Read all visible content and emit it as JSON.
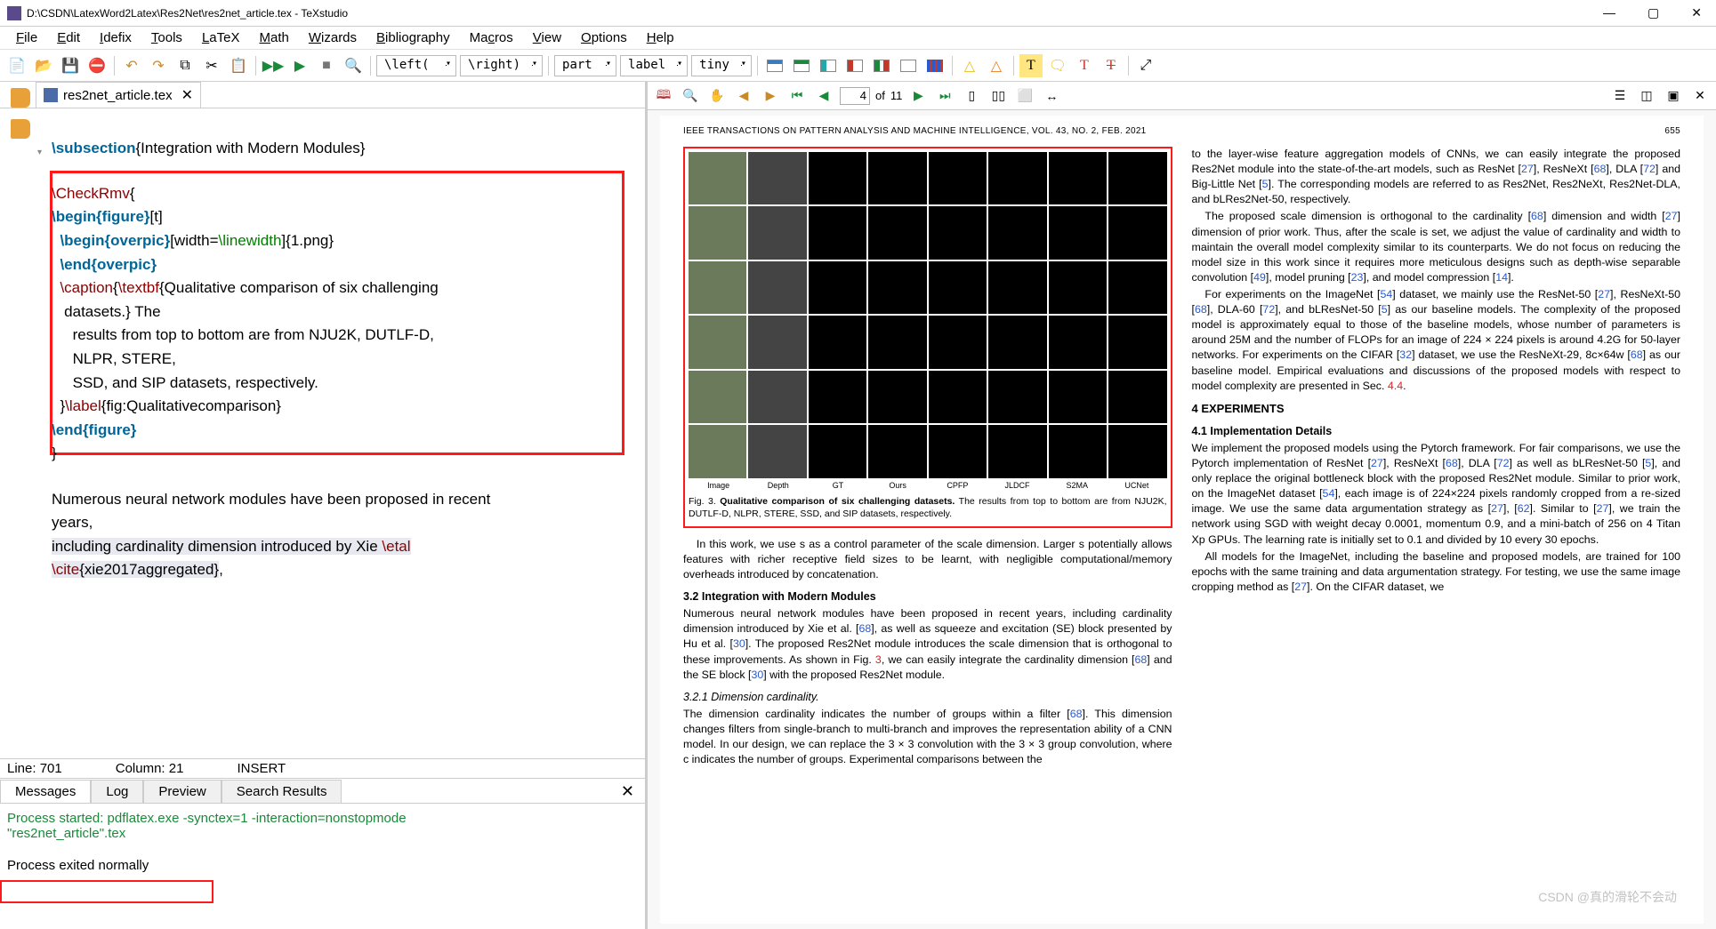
{
  "window": {
    "title": "D:\\CSDN\\LatexWord2Latex\\Res2Net\\res2net_article.tex - TeXstudio"
  },
  "menu": [
    "File",
    "Edit",
    "Idefix",
    "Tools",
    "LaTeX",
    "Math",
    "Wizards",
    "Bibliography",
    "Macros",
    "View",
    "Options",
    "Help"
  ],
  "combos": {
    "left": "\\left(",
    "right": "\\right)",
    "part": "part",
    "label": "label",
    "tiny": "tiny"
  },
  "tabs": {
    "file": "res2net_article.tex"
  },
  "code": {
    "l1a": "\\subsection",
    "l1b": "{Integration with Modern Modules}",
    "l3a": "\\CheckRmv",
    "l3b": "{",
    "l4a": "\\begin{figure}",
    "l4b": "[t]",
    "l5a": "  \\begin{overpic}",
    "l5b": "[width=",
    "l5c": "\\linewidth",
    "l5d": "]{1.png}",
    "l6a": "  \\end{overpic}",
    "l7a": "  \\caption",
    "l7b": "{",
    "l7c": "\\textbf",
    "l7d": "{Qualitative comparison of six challenging",
    "l8": "   datasets.}",
    "l8b": " The",
    "l9": "     results from top to bottom are from NJU2K, DUTLF-D,",
    "l10": "     NLPR, STERE,",
    "l11": "     SSD, and SIP datasets, respectively.",
    "l12a": "  }",
    "l12b": "\\label",
    "l12c": "{fig:Qualitativecomparison}",
    "l13a": "\\end{figure}",
    "l14": "}",
    "l16": "Numerous neural network modules have been proposed in recent",
    "l17": "years,",
    "l18a": "including cardinality dimension introduced by Xie ",
    "l18b": "\\etal",
    "l19a": "\\cite",
    "l19b": "{xie2017aggregated}",
    "l19c": ","
  },
  "status": {
    "line": "Line: 701",
    "col": "Column: 21",
    "mode": "INSERT"
  },
  "log": {
    "tabs": [
      "Messages",
      "Log",
      "Preview",
      "Search Results"
    ],
    "l1": "Process started: pdflatex.exe -synctex=1 -interaction=nonstopmode",
    "l2": "\"res2net_article\".tex",
    "l3": "Process exited normally"
  },
  "pdf": {
    "page_current": "4",
    "page_of": "of",
    "page_total": "11",
    "header_left": "IEEE TRANSACTIONS ON PATTERN ANALYSIS AND MACHINE INTELLIGENCE, VOL. 43, NO. 2, FEB. 2021",
    "header_right": "655",
    "fig_labels": [
      "Image",
      "Depth",
      "GT",
      "Ours",
      "CPFP",
      "JLDCF",
      "S2MA",
      "UCNet"
    ],
    "fig_caption_a": "Fig. 3. ",
    "fig_caption_b": "Qualitative comparison of six challenging datasets.",
    "fig_caption_c": " The results from top to bottom are from NJU2K, DUTLF-D, NLPR, STERE, SSD, and SIP datasets, respectively.",
    "leftcol": {
      "p1": "In this work, we use s as a control parameter of the scale dimension. Larger s potentially allows features with richer receptive field sizes to be learnt, with negligible computational/memory overheads introduced by concatenation.",
      "h1": "3.2   Integration with Modern Modules",
      "p2a": "Numerous neural network modules have been proposed in recent years, including cardinality dimension introduced by Xie et al. [",
      "p2b": "], as well as squeeze and excitation (SE) block presented by Hu et al. [",
      "p2c": "]. The proposed Res2Net module introduces the scale dimension that is orthogonal to these improvements. As shown in Fig. ",
      "p2d": ", we can easily integrate the cardinality dimension  [",
      "p2e": "] and the SE block [",
      "p2f": "] with the proposed Res2Net module.",
      "h2": "3.2.1   Dimension cardinality.",
      "p3a": "The dimension cardinality indicates the number of groups within a filter [",
      "p3b": "]. This dimension changes filters from single-branch to multi-branch and improves the representation ability of a CNN model. In our design, we can replace the 3 × 3 convolution with the 3 × 3 group convolution, where c indicates the number of groups. Experimental comparisons between the"
    },
    "rightcol": {
      "p1a": "to the layer-wise feature aggregation models of CNNs, we can easily integrate the proposed Res2Net module into the state-of-the-art  models, such as ResNet [",
      "p1b": "], ResNeXt [",
      "p1c": "], DLA [",
      "p1d": "] and Big-Little Net [",
      "p1e": "]. The corresponding models are referred to as Res2Net, Res2NeXt, Res2Net-DLA, and bLRes2Net-50, respectively.",
      "p2a": "The proposed scale dimension is orthogonal to the cardinality [",
      "p2b": "] dimension and width [",
      "p2c": "] dimension of prior work. Thus, after the scale is set, we adjust the value of cardinality and width to maintain the overall model complexity similar to its counterparts. We do not focus on reducing the model size in this work since it requires more meticulous designs such as depth-wise separable convolution [",
      "p2d": "], model pruning [",
      "p2e": "], and model compression [",
      "p2f": "].",
      "p3a": "For experiments on the ImageNet [",
      "p3b": "] dataset, we mainly use the ResNet-50 [",
      "p3c": "], ResNeXt-50 [",
      "p3d": "], DLA-60 [",
      "p3e": "], and bLResNet-50 [",
      "p3f": "] as our baseline models. The complexity of the proposed model is approximately equal to those of the baseline models, whose number of parameters is around 25M and the number of FLOPs for an image of 224 × 224 pixels is around 4.2G for 50-layer networks. For experiments on the CIFAR [",
      "p3g": "] dataset, we use the ResNeXt-29, 8c×64w [",
      "p3h": "] as our baseline model. Empirical evaluations and discussions of the proposed models with respect to model complexity are presented in Sec. ",
      "p3i": ".",
      "h1": "4   EXPERIMENTS",
      "h2": "4.1   Implementation Details",
      "p4a": "We implement the proposed models using the Pytorch framework. For fair comparisons, we use the Pytorch implementation of ResNet [",
      "p4b": "], ResNeXt [",
      "p4c": "], DLA [",
      "p4d": "] as well as bLResNet-50 [",
      "p4e": "], and only replace the original bottleneck block with the proposed Res2Net module. Similar to prior work, on the ImageNet dataset [",
      "p4f": "], each image is of 224×224 pixels randomly cropped from a re-sized image. We use the same data argumentation strategy as [",
      "p4g": "], [",
      "p4h": "]. Similar to [",
      "p4i": "], we train the network using SGD with weight decay 0.0001, momentum 0.9, and a mini-batch of 256 on 4 Titan Xp GPUs. The learning rate is initially set to 0.1 and divided by 10 every 30 epochs.",
      "p5a": "All models for the ImageNet, including the baseline and proposed models, are trained for 100 epochs with the same training and data argumentation strategy. For testing, we use the same image cropping method as [",
      "p5b": "]. On the CIFAR dataset, we"
    },
    "refs": {
      "r27": "27",
      "r68": "68",
      "r72": "72",
      "r5": "5",
      "r30": "30",
      "r49": "49",
      "r23": "23",
      "r14": "14",
      "r54": "54",
      "r32": "32",
      "r62": "62",
      "r3": "3",
      "sec44": "4.4"
    },
    "watermark": "CSDN @真的滑轮不会动"
  }
}
